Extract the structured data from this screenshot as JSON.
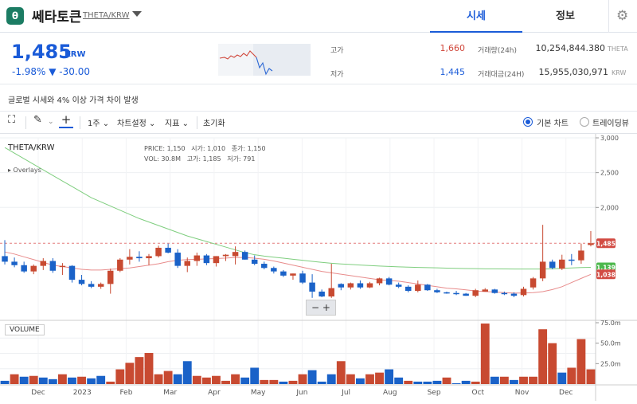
{
  "header": {
    "logo_glyph": "θ",
    "coin_name": "쎄타토큰",
    "pair": "THETA/KRW",
    "tabs": [
      "시세",
      "정보"
    ],
    "active_tab": "시세"
  },
  "quote": {
    "price": "1,485",
    "currency": "KRW",
    "change": "-1.98% ▼ -30.00",
    "high_label": "고가",
    "high": "1,660",
    "low_label": "저가",
    "low": "1,445",
    "volume24_label": "거래량(24h)",
    "volume24": "10,254,844.380",
    "volume24_unit": "THETA",
    "value24_label": "거래대금(24H)",
    "value24": "15,955,030,971",
    "value24_unit": "KRW"
  },
  "notice": "글로벌 시세와 4% 이상 가격 차이 발생",
  "toolbar": {
    "interval": "1주",
    "chart_settings": "차트설정",
    "indicators": "지표",
    "reset": "초기화",
    "basic_chart": "기본 차트",
    "tradingview": "트레이딩뷰"
  },
  "chart": {
    "symbol": "THETA/KRW",
    "ohlc": {
      "price_label": "PRICE:",
      "price": "1,150",
      "open_label": "시가:",
      "open": "1,010",
      "close_label": "종가:",
      "close": "1,150",
      "vol_label": "VOL:",
      "vol": "30.8M",
      "high_label": "고가:",
      "high": "1,185",
      "low_label": "저가:",
      "low": "791"
    },
    "overlays_label": "▸ Overlays",
    "volume_label": "VOLUME",
    "price_ticks": [
      "3,000",
      "2,500",
      "2,000"
    ],
    "volume_ticks": [
      "75.0m",
      "50.0m",
      "25.0m"
    ],
    "badges": {
      "last": "1,485",
      "ma_green": "1,139",
      "ma_red": "1,038"
    },
    "colors": {
      "up": "#c84a31",
      "down": "#1a62c8",
      "ma_long": "#7fce7f",
      "ma_short": "#e88c8c"
    }
  },
  "chart_data": {
    "type": "candlestick",
    "x_labels": [
      "Dec",
      "2023",
      "Feb",
      "Mar",
      "Apr",
      "May",
      "Jun",
      "Jul",
      "Aug",
      "Sep",
      "Oct",
      "Nov",
      "Dec"
    ],
    "ylim": [
      400,
      3000
    ],
    "candles": [
      [
        1300,
        1530,
        1180,
        1220
      ],
      [
        1220,
        1280,
        1140,
        1170
      ],
      [
        1170,
        1220,
        1060,
        1080
      ],
      [
        1080,
        1180,
        1040,
        1160
      ],
      [
        1160,
        1270,
        1100,
        1230
      ],
      [
        1230,
        1270,
        1060,
        1090
      ],
      [
        1150,
        1200,
        1030,
        1160
      ],
      [
        1160,
        1170,
        920,
        960
      ],
      [
        960,
        1030,
        880,
        900
      ],
      [
        900,
        940,
        840,
        860
      ],
      [
        860,
        920,
        830,
        900
      ],
      [
        900,
        1120,
        760,
        1090
      ],
      [
        1090,
        1270,
        1070,
        1250
      ],
      [
        1250,
        1400,
        1180,
        1290
      ],
      [
        1290,
        1370,
        1220,
        1270
      ],
      [
        1270,
        1330,
        1170,
        1300
      ],
      [
        1300,
        1450,
        1280,
        1420
      ],
      [
        1420,
        1480,
        1340,
        1350
      ],
      [
        1350,
        1400,
        1130,
        1160
      ],
      [
        1160,
        1280,
        1070,
        1230
      ],
      [
        1230,
        1350,
        1160,
        1310
      ],
      [
        1310,
        1330,
        1170,
        1200
      ],
      [
        1200,
        1300,
        1150,
        1300
      ],
      [
        1300,
        1330,
        1230,
        1320
      ],
      [
        1300,
        1440,
        1180,
        1360
      ],
      [
        1360,
        1380,
        1250,
        1250
      ],
      [
        1250,
        1310,
        1170,
        1190
      ],
      [
        1190,
        1220,
        1110,
        1130
      ],
      [
        1130,
        1150,
        1050,
        1080
      ],
      [
        1080,
        1100,
        1000,
        1020
      ],
      [
        1020,
        1050,
        960,
        1050
      ],
      [
        1050,
        1090,
        900,
        920
      ],
      [
        920,
        1040,
        700,
        790
      ],
      [
        790,
        820,
        710,
        720
      ],
      [
        720,
        1190,
        700,
        840
      ],
      [
        900,
        910,
        810,
        850
      ],
      [
        850,
        920,
        820,
        910
      ],
      [
        910,
        950,
        830,
        850
      ],
      [
        850,
        930,
        840,
        910
      ],
      [
        910,
        990,
        880,
        980
      ],
      [
        980,
        1000,
        880,
        890
      ],
      [
        890,
        920,
        840,
        860
      ],
      [
        860,
        880,
        780,
        800
      ],
      [
        800,
        950,
        780,
        890
      ],
      [
        890,
        900,
        800,
        810
      ],
      [
        810,
        830,
        770,
        780
      ],
      [
        780,
        790,
        760,
        770
      ],
      [
        770,
        800,
        740,
        760
      ],
      [
        760,
        770,
        730,
        730
      ],
      [
        730,
        830,
        710,
        810
      ],
      [
        790,
        840,
        790,
        820
      ],
      [
        820,
        830,
        760,
        770
      ],
      [
        770,
        790,
        740,
        760
      ],
      [
        760,
        780,
        710,
        730
      ],
      [
        740,
        860,
        720,
        830
      ],
      [
        850,
        1000,
        820,
        980
      ],
      [
        980,
        1750,
        940,
        1220
      ],
      [
        1220,
        1250,
        1110,
        1130
      ],
      [
        1120,
        1320,
        1100,
        1250
      ],
      [
        1250,
        1330,
        1170,
        1240
      ],
      [
        1240,
        1480,
        1190,
        1380
      ],
      [
        1460,
        1660,
        1440,
        1485
      ]
    ],
    "volume": [
      [
        4,
        "d"
      ],
      [
        12,
        "u"
      ],
      [
        9,
        "d"
      ],
      [
        10,
        "u"
      ],
      [
        8,
        "d"
      ],
      [
        6,
        "d"
      ],
      [
        12,
        "u"
      ],
      [
        8,
        "d"
      ],
      [
        9,
        "u"
      ],
      [
        7,
        "d"
      ],
      [
        10,
        "d"
      ],
      [
        3,
        "u"
      ],
      [
        18,
        "u"
      ],
      [
        26,
        "u"
      ],
      [
        33,
        "u"
      ],
      [
        38,
        "u"
      ],
      [
        12,
        "u"
      ],
      [
        16,
        "u"
      ],
      [
        12,
        "d"
      ],
      [
        28,
        "d"
      ],
      [
        10,
        "u"
      ],
      [
        8,
        "u"
      ],
      [
        10,
        "u"
      ],
      [
        4,
        "u"
      ],
      [
        12,
        "u"
      ],
      [
        8,
        "d"
      ],
      [
        20,
        "d"
      ],
      [
        5,
        "u"
      ],
      [
        5,
        "u"
      ],
      [
        3,
        "d"
      ],
      [
        4,
        "u"
      ],
      [
        12,
        "u"
      ],
      [
        17,
        "d"
      ],
      [
        3,
        "d"
      ],
      [
        12,
        "d"
      ],
      [
        28,
        "u"
      ],
      [
        12,
        "u"
      ],
      [
        7,
        "d"
      ],
      [
        12,
        "u"
      ],
      [
        14,
        "u"
      ],
      [
        18,
        "d"
      ],
      [
        8,
        "d"
      ],
      [
        4,
        "u"
      ],
      [
        3,
        "d"
      ],
      [
        3,
        "d"
      ],
      [
        4,
        "d"
      ],
      [
        8,
        "u"
      ],
      [
        1,
        "d"
      ],
      [
        4,
        "d"
      ],
      [
        3,
        "u"
      ],
      [
        74,
        "u"
      ],
      [
        9,
        "d"
      ],
      [
        9,
        "u"
      ],
      [
        5,
        "d"
      ],
      [
        9,
        "u"
      ],
      [
        9,
        "u"
      ],
      [
        67,
        "u"
      ],
      [
        50,
        "u"
      ],
      [
        14,
        "d"
      ],
      [
        20,
        "u"
      ],
      [
        55,
        "u"
      ],
      [
        18,
        "u"
      ]
    ],
    "ma_long": [
      2860,
      2780,
      2700,
      2620,
      2540,
      2460,
      2380,
      2300,
      2220,
      2140,
      2080,
      2020,
      1960,
      1900,
      1840,
      1790,
      1740,
      1690,
      1640,
      1590,
      1550,
      1510,
      1470,
      1430,
      1390,
      1350,
      1320,
      1300,
      1285,
      1270,
      1255,
      1240,
      1225,
      1210,
      1198,
      1188,
      1180,
      1172,
      1165,
      1158,
      1152,
      1146,
      1142,
      1138,
      1135,
      1132,
      1128,
      1125,
      1122,
      1120,
      1118,
      1118,
      1116,
      1114,
      1114,
      1114,
      1114,
      1118,
      1124,
      1130,
      1136,
      1139
    ],
    "ma_short": [
      1360,
      1330,
      1290,
      1250,
      1210,
      1170,
      1150,
      1130,
      1110,
      1100,
      1100,
      1110,
      1120,
      1130,
      1150,
      1170,
      1190,
      1220,
      1240,
      1250,
      1255,
      1260,
      1265,
      1272,
      1280,
      1280,
      1270,
      1255,
      1230,
      1200,
      1170,
      1140,
      1110,
      1080,
      1060,
      1040,
      1020,
      1000,
      980,
      960,
      950,
      940,
      920,
      900,
      880,
      860,
      840,
      830,
      815,
      800,
      790,
      785,
      775,
      770,
      770,
      775,
      790,
      820,
      860,
      920,
      980,
      1038
    ]
  }
}
